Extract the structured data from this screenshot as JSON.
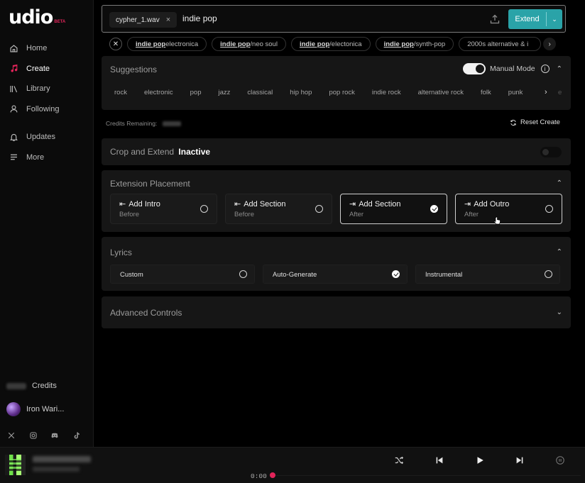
{
  "brand": {
    "name": "udio",
    "badge": "BETA"
  },
  "sidebar": {
    "items": [
      {
        "label": "Home",
        "icon": "home-icon"
      },
      {
        "label": "Create",
        "icon": "music-note-icon",
        "active": true,
        "color": "#e2245a"
      },
      {
        "label": "Library",
        "icon": "library-icon"
      },
      {
        "label": "Following",
        "icon": "user-icon"
      },
      {
        "label": "Updates",
        "icon": "bell-icon"
      },
      {
        "label": "More",
        "icon": "menu-icon"
      }
    ],
    "credits_label": "Credits",
    "user_name": "Iron Wari...",
    "social": [
      "x-icon",
      "instagram-icon",
      "discord-icon",
      "tiktok-icon"
    ]
  },
  "prompt": {
    "file_chip": "cypher_1.wav",
    "file_chip_close": "×",
    "text": "indie pop",
    "extend_label": "Extend"
  },
  "tag_suggestions": {
    "clear": "✕",
    "items": [
      {
        "bold": "indie pop",
        "rest": " electronica"
      },
      {
        "bold": "indie pop",
        "rest": "/neo soul"
      },
      {
        "bold": "indie pop",
        "rest": "/electonica"
      },
      {
        "bold": "indie pop",
        "rest": "/synth-pop"
      },
      {
        "bold": "",
        "rest": "2000s alternative & i"
      }
    ]
  },
  "suggestions": {
    "title": "Suggestions",
    "manual_mode_label": "Manual Mode",
    "manual_mode_on": true,
    "genres": [
      "rock",
      "electronic",
      "pop",
      "jazz",
      "classical",
      "hip hop",
      "pop rock",
      "indie rock",
      "alternative rock",
      "folk",
      "punk"
    ],
    "overflow_text": "e"
  },
  "credits_remaining_label": "Credits Remaining:",
  "reset_label": "Reset Create",
  "crop_extend": {
    "title": "Crop and Extend",
    "status": "Inactive",
    "enabled": false
  },
  "extension_placement": {
    "title": "Extension Placement",
    "options": [
      {
        "arrow": "⇤",
        "label": "Add Intro",
        "sub": "Before",
        "selected": false
      },
      {
        "arrow": "⇤",
        "label": "Add Section",
        "sub": "Before",
        "selected": false
      },
      {
        "arrow": "⇥",
        "label": "Add Section",
        "sub": "After",
        "selected": true
      },
      {
        "arrow": "⇥",
        "label": "Add Outro",
        "sub": "After",
        "selected": false
      }
    ]
  },
  "lyrics": {
    "title": "Lyrics",
    "options": [
      {
        "label": "Custom",
        "selected": false
      },
      {
        "label": "Auto-Generate",
        "selected": true
      },
      {
        "label": "Instrumental",
        "selected": false
      }
    ]
  },
  "advanced_controls": {
    "title": "Advanced Controls"
  },
  "player": {
    "time": "0:00",
    "accent": "#e2245a"
  },
  "colors": {
    "accent": "#2aa3a8",
    "brand": "#e2245a"
  }
}
